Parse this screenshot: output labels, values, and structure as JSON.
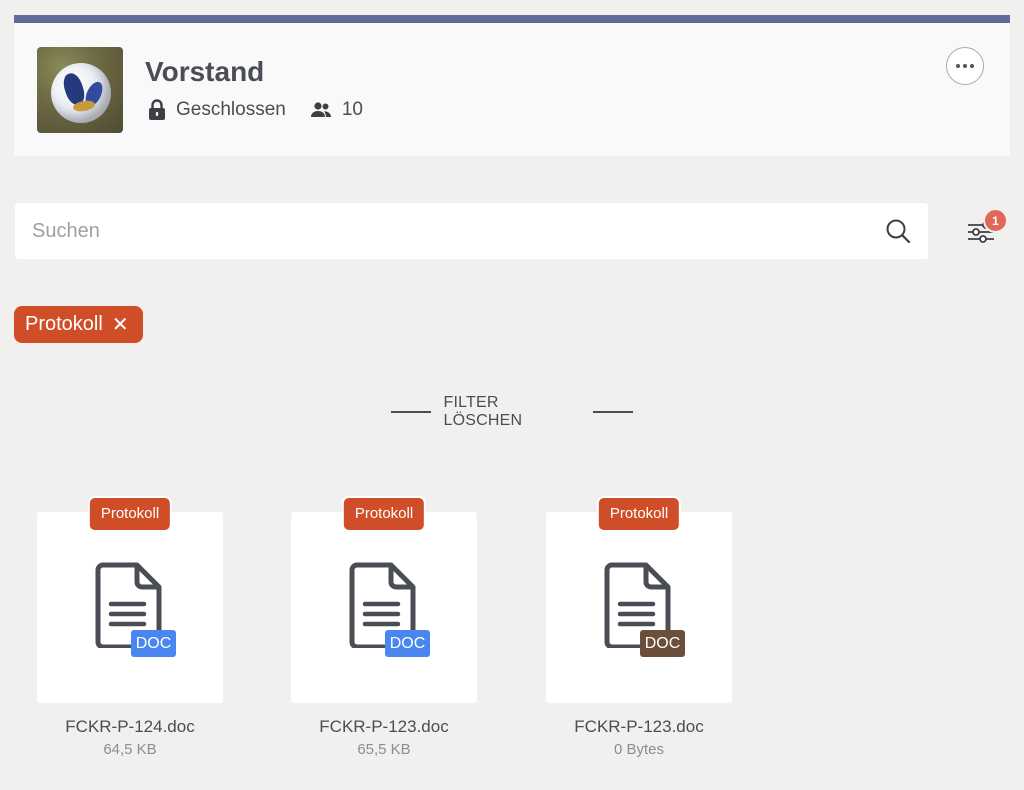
{
  "group": {
    "title": "Vorstand",
    "privacy": "Geschlossen",
    "member_count": "10"
  },
  "search": {
    "placeholder": "Suchen"
  },
  "filter": {
    "badge_count": "1"
  },
  "active_chip": {
    "label": "Protokoll",
    "remove_symbol": "✕"
  },
  "clear_filter_label": "FILTER LÖSCHEN",
  "files": [
    {
      "tag": "Protokoll",
      "ext": "DOC",
      "ext_color": "#4a86f0",
      "name": "FCKR-P-124.doc",
      "size": "64,5 KB"
    },
    {
      "tag": "Protokoll",
      "ext": "DOC",
      "ext_color": "#4a86f0",
      "name": "FCKR-P-123.doc",
      "size": "65,5 KB"
    },
    {
      "tag": "Protokoll",
      "ext": "DOC",
      "ext_color": "#6b4f3a",
      "name": "FCKR-P-123.doc",
      "size": "0 Bytes"
    }
  ],
  "colors": {
    "accent_bar": "#5d6c9a",
    "chip": "#cf4e28",
    "badge": "#e2675b"
  }
}
